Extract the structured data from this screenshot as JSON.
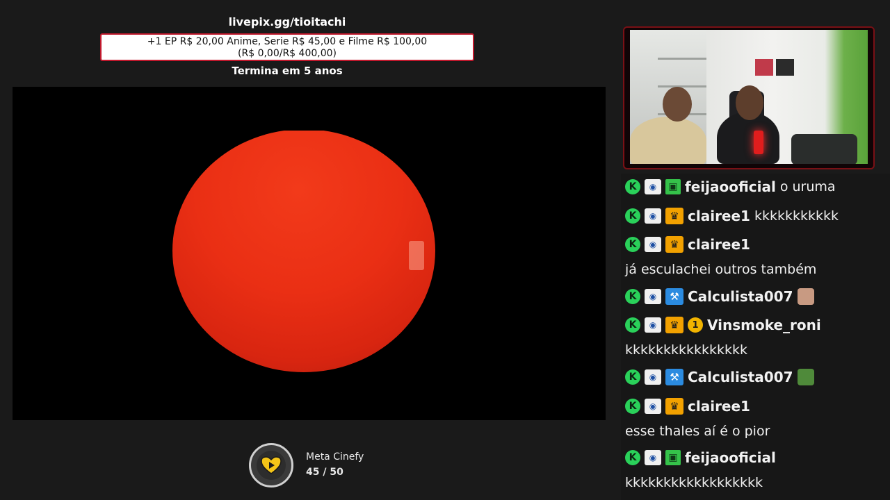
{
  "donation": {
    "url": "livepix.gg/tioitachi",
    "offer_line1": "+1 EP R$ 20,00 Anime, Serie R$ 45,00 e Filme R$ 100,00",
    "offer_line2": "(R$ 0,00/R$ 400,00)",
    "ends": "Termina em 5 anos",
    "progress_fraction": 0.0
  },
  "meta": {
    "label": "Meta Cinefy",
    "count": "45 / 50",
    "icon": "play-heart-icon"
  },
  "colors": {
    "accent_red": "#c0182c",
    "sphere_red": "#ea2f14",
    "chat_bg": "#171717",
    "kick_green": "#2ad15a",
    "sub_gold": "#f2a100",
    "mod_blue": "#2b8be0"
  },
  "chat": {
    "messages": [
      {
        "user": "feijaooficial",
        "badge": "gift-icon",
        "text": "o uruma"
      },
      {
        "user": "clairee1",
        "badge": "crown-icon",
        "text": "kkkkkkkkkkk"
      },
      {
        "user": "clairee1",
        "badge": "crown-icon",
        "text": "já esculachei outros também"
      },
      {
        "user": "Calculista007",
        "badge": "hammer-icon",
        "text": ""
      },
      {
        "user": "Vinsmoke_roni",
        "badge": "crown-icon",
        "badge2": "1",
        "text": "kkkkkkkkkkkkkkkk"
      },
      {
        "user": "Calculista007",
        "badge": "hammer-icon",
        "text": ""
      },
      {
        "user": "clairee1",
        "badge": "crown-icon",
        "text": "esse thales aí é o pior"
      },
      {
        "user": "feijaooficial",
        "badge": "gift-icon",
        "text": "kkkkkkkkkkkkkkkkkk"
      }
    ]
  }
}
